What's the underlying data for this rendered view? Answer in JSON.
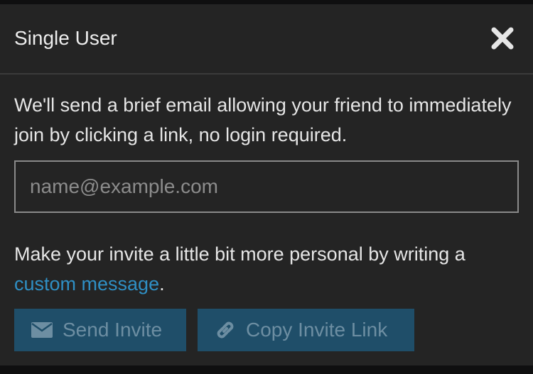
{
  "dialog": {
    "title": "Single User",
    "close_icon": "close-icon"
  },
  "description": "We'll send a brief email allowing your friend to immediately join by clicking a link, no login required.",
  "email_input": {
    "placeholder": "name@example.com",
    "value": ""
  },
  "personal": {
    "text_before": "Make your invite a little bit more personal by writing a ",
    "link_label": "custom message",
    "text_after": "."
  },
  "buttons": {
    "send_label": "Send Invite",
    "send_icon": "envelope-icon",
    "copy_label": "Copy Invite Link",
    "copy_icon": "link-icon"
  },
  "colors": {
    "background": "#242424",
    "link": "#2f8fc4",
    "button_bg": "#1f4e69",
    "button_text": "#6d8ea2"
  }
}
